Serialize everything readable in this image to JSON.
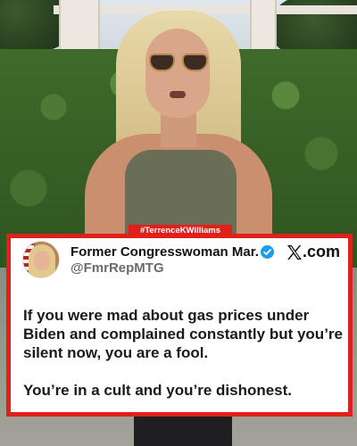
{
  "overlay_tag": "#TerrenceKWilliams",
  "tweet": {
    "author_name": "Former Congresswoman Mar...",
    "handle": "@FmrRepMTG",
    "verified": true,
    "site_label": ".com",
    "logo_icon": "x-logo-icon",
    "paragraphs": [
      "If you were mad about gas prices under Biden and complained constantly but you’re silent now, you are a fool.",
      "You’re in a cult and you’re dishonest."
    ]
  },
  "colors": {
    "accent_border": "#e0201b",
    "verified_blue": "#1d9bf0"
  }
}
